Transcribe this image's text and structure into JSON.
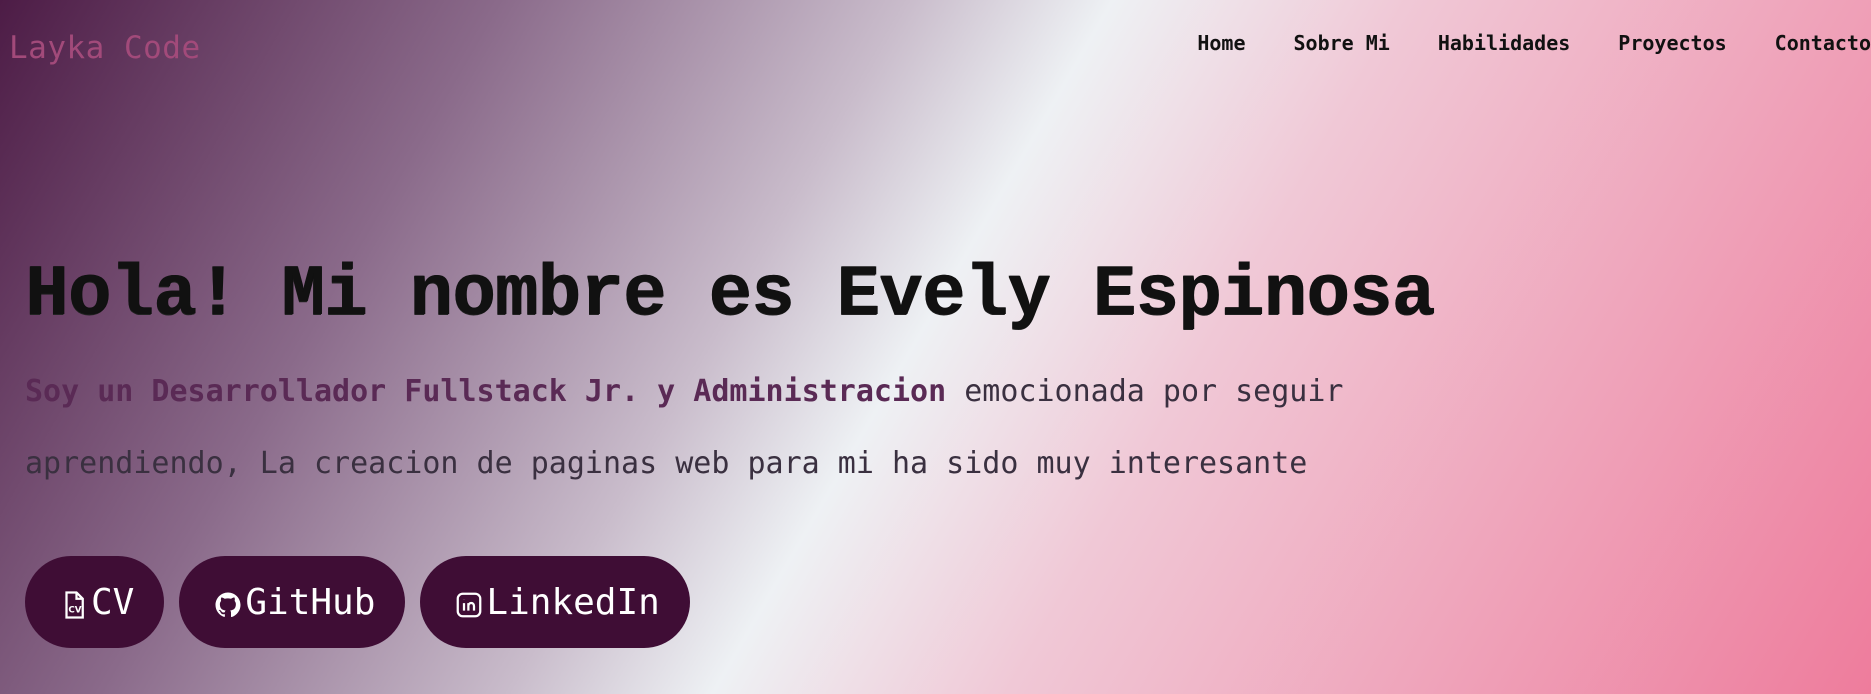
{
  "brand": "Layka Code",
  "nav": {
    "items": [
      {
        "label": "Home"
      },
      {
        "label": "Sobre Mi"
      },
      {
        "label": "Habilidades"
      },
      {
        "label": "Proyectos"
      },
      {
        "label": "Contacto"
      }
    ]
  },
  "hero": {
    "title": "Hola! Mi nombre es Evely Espinosa",
    "highlight": "Soy un Desarrollador Fullstack Jr. y Administracion",
    "text_rest": " emocionada por seguir aprendiendo, La creacion de paginas web para mi ha sido muy interesante"
  },
  "buttons": {
    "cv": {
      "label": "CV",
      "icon": "cv-file-icon"
    },
    "github": {
      "label": "GitHub",
      "icon": "github-icon"
    },
    "linkedin": {
      "label": "LinkedIn",
      "icon": "linkedin-icon"
    }
  },
  "colors": {
    "brand": "#a24a7a",
    "button_bg": "#3f0d35",
    "button_text": "#ffffff",
    "highlight_text": "#5a2a55"
  }
}
